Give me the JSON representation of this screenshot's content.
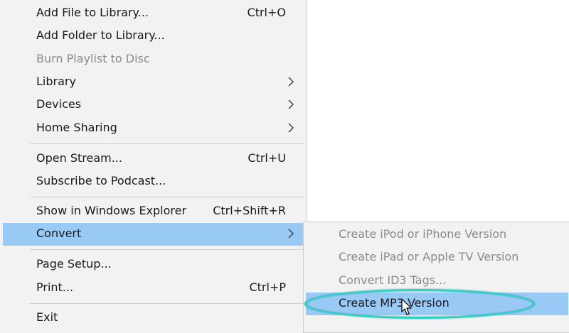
{
  "menu": {
    "items": [
      {
        "label": "Add File to Library...",
        "shortcut": "Ctrl+O"
      },
      {
        "label": "Add Folder to Library..."
      },
      {
        "label": "Burn Playlist to Disc"
      },
      {
        "label": "Library"
      },
      {
        "label": "Devices"
      },
      {
        "label": "Home Sharing"
      },
      {
        "label": "Open Stream...",
        "shortcut": "Ctrl+U"
      },
      {
        "label": "Subscribe to Podcast..."
      },
      {
        "label": "Show in Windows Explorer",
        "shortcut": "Ctrl+Shift+R"
      },
      {
        "label": "Convert"
      },
      {
        "label": "Page Setup..."
      },
      {
        "label": "Print...",
        "shortcut": "Ctrl+P"
      },
      {
        "label": "Exit"
      }
    ]
  },
  "submenu": {
    "items": [
      {
        "label": "Create iPod or iPhone Version"
      },
      {
        "label": "Create iPad or Apple TV Version"
      },
      {
        "label": "Convert ID3 Tags..."
      },
      {
        "label": "Create MP3 Version"
      }
    ]
  },
  "colors": {
    "menu_bg": "#f2f2f2",
    "highlight": "#99c9f5",
    "disabled_text": "#8a8a8a",
    "annotation_ellipse": "#2fd0c7"
  }
}
